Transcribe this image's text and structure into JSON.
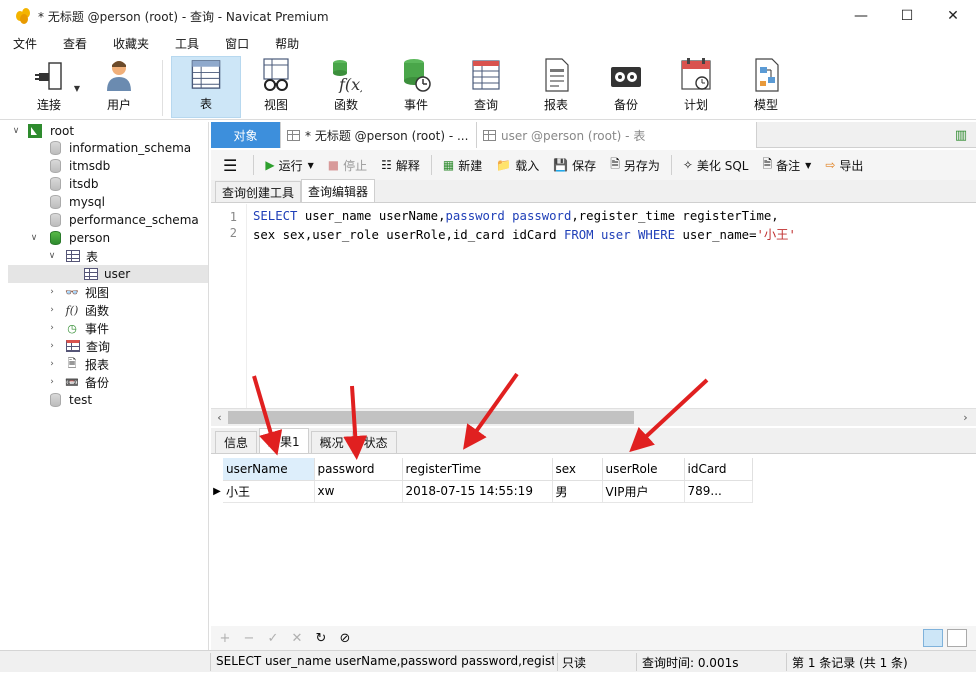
{
  "window": {
    "title": "* 无标题 @person (root) - 查询 - Navicat Premium",
    "controls": [
      "minimize",
      "maximize",
      "close"
    ]
  },
  "menu": [
    "文件",
    "查看",
    "收藏夹",
    "工具",
    "窗口",
    "帮助"
  ],
  "toolbar": {
    "items": [
      {
        "label": "连接",
        "icon": "plug-icon"
      },
      {
        "label": "用户",
        "icon": "user-icon"
      },
      {
        "label": "表",
        "icon": "table-icon",
        "active": true
      },
      {
        "label": "视图",
        "icon": "view-glasses-icon"
      },
      {
        "label": "函数",
        "icon": "function-icon"
      },
      {
        "label": "事件",
        "icon": "event-clock-icon"
      },
      {
        "label": "查询",
        "icon": "query-icon"
      },
      {
        "label": "报表",
        "icon": "report-icon"
      },
      {
        "label": "备份",
        "icon": "backup-icon"
      },
      {
        "label": "计划",
        "icon": "calendar-icon"
      },
      {
        "label": "模型",
        "icon": "model-icon"
      }
    ]
  },
  "tree": {
    "root": "root",
    "databases": [
      "information_schema",
      "itmsdb",
      "itsdb",
      "mysql",
      "performance_schema",
      "person"
    ],
    "person_children": {
      "tables_label": "表",
      "table_user": "user",
      "view": "视图",
      "function": "函数",
      "event": "事件",
      "query": "查询",
      "report": "报表",
      "backup": "备份"
    },
    "last_db": "test"
  },
  "tabs": {
    "object": "对象",
    "active": "* 无标题 @person (root) - ...",
    "inactive": "user @person (root) - 表"
  },
  "query_toolbar": {
    "menu_icon": "hamburger-icon",
    "run": "运行",
    "stop": "停止",
    "explain": "解释",
    "new": "新建",
    "load": "载入",
    "save": "保存",
    "save_as": "另存为",
    "beautify": "美化 SQL",
    "comment": "备注",
    "export": "导出"
  },
  "subtabs": [
    "查询创建工具",
    "查询编辑器"
  ],
  "editor": {
    "line_numbers": [
      "1",
      "2"
    ],
    "line1": {
      "t1": "SELECT",
      "t2": " user_name userName,",
      "t3": "password",
      "t4": " ",
      "t5": "password",
      "t6": ",register_time registerTime,"
    },
    "line2": {
      "t1": "sex sex,user_role userRole,id_card idCard ",
      "t2": "FROM",
      "t3": " ",
      "t4": "user",
      "t5": " ",
      "t6": "WHERE",
      "t7": " user_name=",
      "t8": "'小王'"
    }
  },
  "result_tabs": [
    "信息",
    "结果1",
    "概况",
    "状态"
  ],
  "result": {
    "columns": [
      "userName",
      "password",
      "registerTime",
      "sex",
      "userRole",
      "idCard"
    ],
    "rows": [
      [
        "小王",
        "xw",
        "2018-07-15 14:55:19",
        "男",
        "VIP用户",
        "789..."
      ]
    ]
  },
  "bottom_toolbar": [
    "+",
    "−",
    "✓",
    "✕",
    "↻",
    "⊘"
  ],
  "status": {
    "sql": "SELECT user_name userName,password password,registe",
    "mode": "只读",
    "time": "查询时间: 0.001s",
    "records": "第 1 条记录 (共 1 条)"
  },
  "colors": {
    "accent": "#3d8fdc",
    "active_toolbar": "#cde6f7",
    "keyword": "#1f3fb8",
    "string": "#c03030",
    "annotation_arrow": "#e02020"
  }
}
